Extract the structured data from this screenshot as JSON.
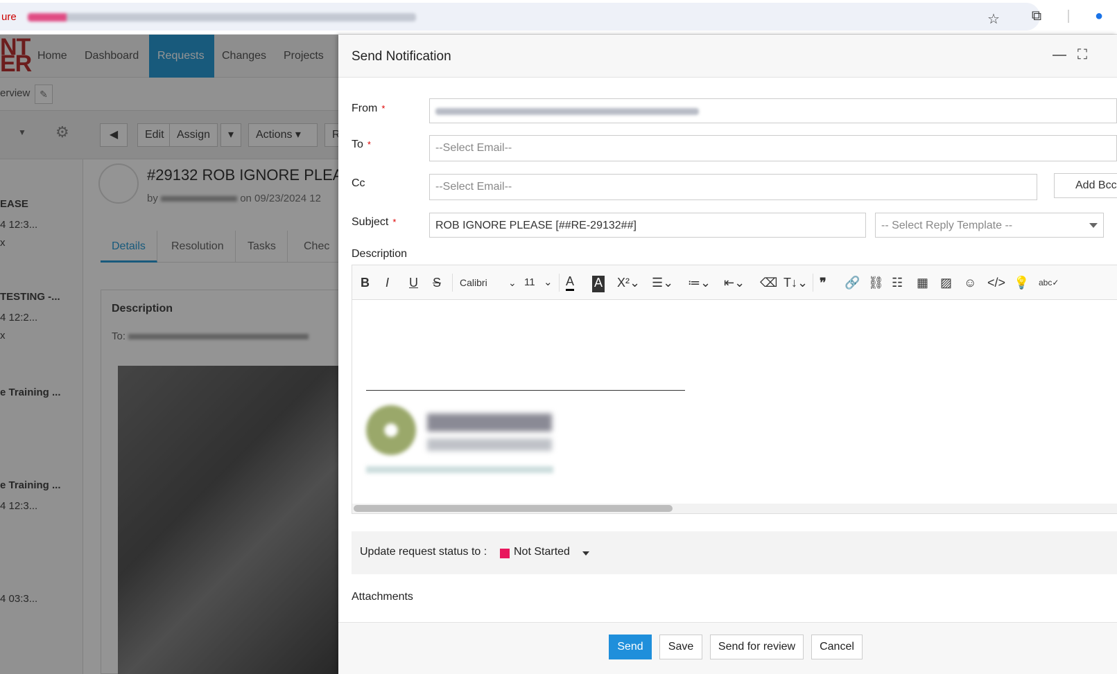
{
  "browser": {
    "security_label": "ure"
  },
  "app": {
    "logo_line1": "NT",
    "logo_line2": "ER",
    "nav": [
      "Home",
      "Dashboard",
      "Requests",
      "Changes",
      "Projects"
    ],
    "sub": {
      "overview": "erview"
    },
    "toolbar": {
      "edit": "Edit",
      "assign": "Assign",
      "actions": "Actions",
      "more": "R"
    },
    "left_list": [
      {
        "title": "EASE",
        "time": "4 12:3...",
        "extra": "x"
      },
      {
        "title": "TESTING -...",
        "time": "4 12:2...",
        "extra": "x"
      },
      {
        "title": "e Training ...",
        "time": "",
        "extra": ""
      },
      {
        "title": "e Training ...",
        "time": "4 12:3...",
        "extra": ""
      },
      {
        "title": "",
        "time": "4 03:3...",
        "extra": ""
      }
    ],
    "ticket": {
      "title": "#29132  ROB IGNORE PLEA",
      "meta_by": "by",
      "meta_on": "on 09/23/2024 12"
    },
    "tabs": [
      "Details",
      "Resolution",
      "Tasks",
      "Chec"
    ],
    "description_heading": "Description",
    "description_to": "To:"
  },
  "dialog": {
    "title": "Send Notification",
    "from_label": "From",
    "to_label": "To",
    "cc_label": "Cc",
    "subject_label": "Subject",
    "to_placeholder": "--Select Email--",
    "cc_placeholder": "--Select Email--",
    "add_bcc": "Add Bcc",
    "subject_value": "ROB IGNORE PLEASE [##RE-29132##]",
    "reply_template": "-- Select Reply Template --",
    "description_label": "Description",
    "editor": {
      "font": "Calibri",
      "size": "11"
    },
    "status_label": "Update request status to   :",
    "status_value": "Not Started",
    "status_color": "#e8185d",
    "attachments_label": "Attachments",
    "buttons": {
      "send": "Send",
      "save": "Save",
      "review": "Send for review",
      "cancel": "Cancel"
    }
  }
}
